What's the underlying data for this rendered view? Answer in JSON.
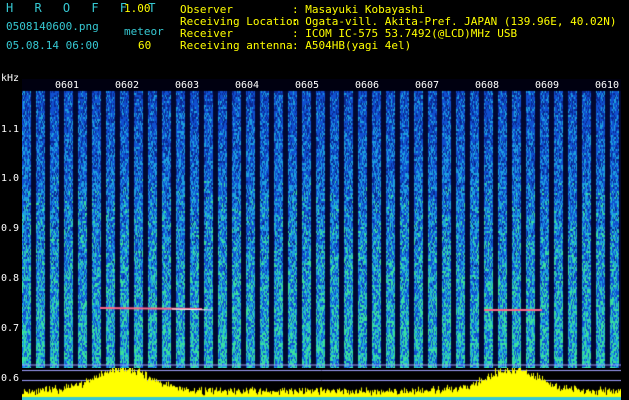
{
  "header": {
    "logo": "H R O F F T",
    "version": "1.00",
    "filename": "0508140600.png",
    "meteor_label": "meteor",
    "datetime": "05.08.14 06:00",
    "meteor_count": "60",
    "info": [
      {
        "label": "Observer",
        "value": ": Masayuki Kobayashi"
      },
      {
        "label": "Receiving Location",
        "value": ": Ogata-vill. Akita-Pref. JAPAN (139.96E, 40.02N)"
      },
      {
        "label": "Receiver",
        "value": ": ICOM IC-575 53.7492(@LCD)MHz USB"
      },
      {
        "label": "Receiving antenna",
        "value": ": A504HB(yagi 4el)"
      }
    ]
  },
  "plot": {
    "y_unit": "kHz",
    "y_labels": [
      "1.1",
      "1.0",
      "0.9",
      "0.8",
      "0.7",
      "0.6"
    ],
    "minute_labels": [
      "0601",
      "0602",
      "0603",
      "0604",
      "0605",
      "0606",
      "0607",
      "0608",
      "0609",
      "0610"
    ]
  },
  "colors": {
    "background": "#000000",
    "header_text": "#36c8d2",
    "info_text": "#ffff00",
    "histogram": "#ffff00"
  }
}
